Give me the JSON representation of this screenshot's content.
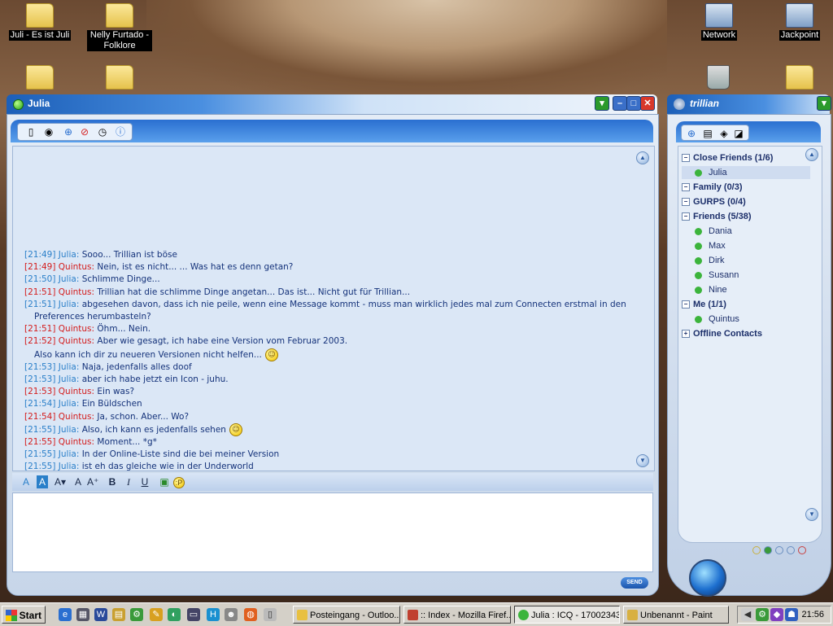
{
  "desktop": {
    "icons": [
      {
        "label": "Juli - Es ist Juli"
      },
      {
        "label": "Nelly Furtado - Folklore"
      },
      {
        "label": "Network"
      },
      {
        "label": "Jackpoint"
      }
    ]
  },
  "chat_window": {
    "title": "Julia",
    "send_label": "SEND",
    "messages": [
      {
        "time": "[21:49]",
        "sender": "Julia:",
        "text": "Sooo... Trillian ist böse"
      },
      {
        "time": "[21:49]",
        "sender": "Quintus:",
        "text": "Nein, ist es nicht... ... Was hat es denn getan?"
      },
      {
        "time": "[21:50]",
        "sender": "Julia:",
        "text": "Schlimme Dinge..."
      },
      {
        "time": "[21:51]",
        "sender": "Quintus:",
        "text": "Trillian hat die schlimme Dinge angetan... Das ist... Nicht gut für Trillian..."
      },
      {
        "time": "[21:51]",
        "sender": "Julia:",
        "text": "abgesehen davon, dass ich nie peile, wenn eine Message kommt - muss man wirklich jedes mal zum Connecten erstmal in den"
      },
      {
        "continuation": "Preferences herumbasteln?"
      },
      {
        "time": "[21:51]",
        "sender": "Quintus:",
        "text": "Öhm... Nein."
      },
      {
        "time": "[21:52]",
        "sender": "Quintus:",
        "text": "Aber wie gesagt, ich habe eine Version vom Februar 2003."
      },
      {
        "continuation": "Also kann ich dir zu neueren Versionen nicht helfen...",
        "smiley": true
      },
      {
        "time": "[21:53]",
        "sender": "Julia:",
        "text": "Naja, jedenfalls alles doof"
      },
      {
        "time": "[21:53]",
        "sender": "Julia:",
        "text": "aber ich habe jetzt ein Icon - juhu."
      },
      {
        "time": "[21:53]",
        "sender": "Quintus:",
        "text": "Ein was?"
      },
      {
        "time": "[21:54]",
        "sender": "Julia:",
        "text": "Ein Büldschen"
      },
      {
        "time": "[21:54]",
        "sender": "Quintus:",
        "text": "Ja, schon. Aber... Wo?"
      },
      {
        "time": "[21:55]",
        "sender": "Julia:",
        "text": "Also, ich kann es jedenfalls sehen",
        "smiley": true
      },
      {
        "time": "[21:55]",
        "sender": "Quintus:",
        "text": "Moment... *g*"
      },
      {
        "time": "[21:55]",
        "sender": "Julia:",
        "text": "In der Online-Liste sind die bei meiner Version"
      },
      {
        "time": "[21:55]",
        "sender": "Julia:",
        "text": "ist eh das gleiche wie in der Underworld"
      }
    ],
    "format_labels": {
      "font_color": "A",
      "bg_color": "A",
      "smaller": "A▾",
      "font": "A",
      "bigger": "A⁺",
      "bold": "B",
      "italic": "I",
      "underline": "U"
    }
  },
  "contact_window": {
    "title": "trillian",
    "groups": [
      {
        "label": "Close Friends (1/6)",
        "toggle": "−",
        "contacts": [
          {
            "name": "Julia",
            "selected": true
          }
        ]
      },
      {
        "label": "Family (0/3)",
        "toggle": "−",
        "contacts": []
      },
      {
        "label": "GURPS (0/4)",
        "toggle": "−",
        "contacts": []
      },
      {
        "label": "Friends (5/38)",
        "toggle": "−",
        "contacts": [
          {
            "name": "Dania"
          },
          {
            "name": "Max"
          },
          {
            "name": "Dirk"
          },
          {
            "name": "Susann"
          },
          {
            "name": "Nine"
          }
        ]
      },
      {
        "label": "Me (1/1)",
        "toggle": "−",
        "contacts": [
          {
            "name": "Quintus"
          }
        ]
      },
      {
        "label": "Offline Contacts",
        "toggle": "+",
        "contacts": []
      }
    ]
  },
  "taskbar": {
    "start_label": "Start",
    "tasks": [
      {
        "label": "Posteingang - Outloo..."
      },
      {
        "label": ":: Index - Mozilla Firef..."
      },
      {
        "label": "Julia : ICQ - 17002343"
      },
      {
        "label": "Unbenannt - Paint"
      }
    ],
    "clock": "21:56"
  }
}
